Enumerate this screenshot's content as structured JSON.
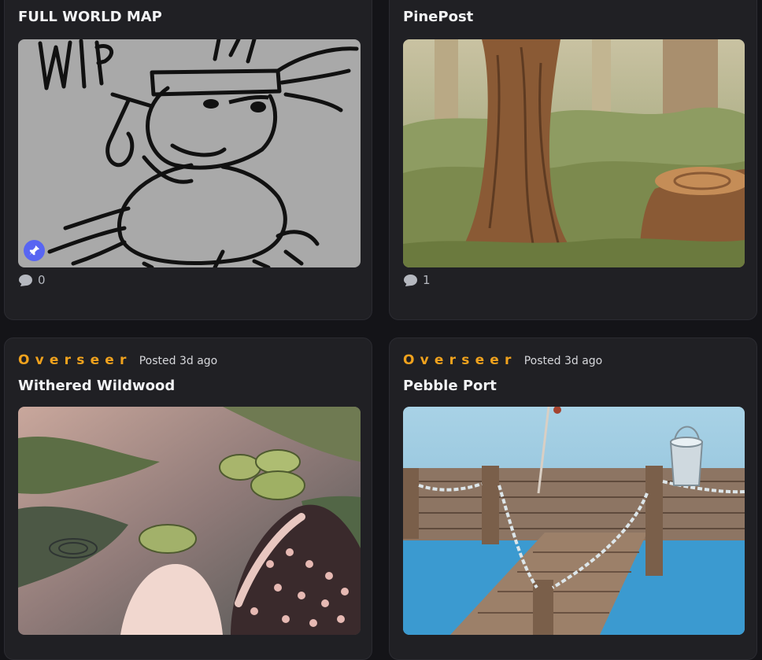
{
  "posts": [
    {
      "title": "FULL WORLD MAP",
      "comment_count": "0",
      "pinned": true,
      "image": "wip-sketch-image"
    },
    {
      "title": "PinePost",
      "comment_count": "1",
      "image": "forest-tree-stump-image"
    },
    {
      "author": "Overseer",
      "posted": "Posted 3d ago",
      "title": "Withered Wildwood",
      "image": "swamp-mushrooms-image"
    },
    {
      "author": "Overseer",
      "posted": "Posted 3d ago",
      "title": "Pebble Port",
      "image": "wooden-dock-image"
    }
  ],
  "icons": {
    "comment": "speech-bubble-icon",
    "pin": "pin-icon"
  },
  "colors": {
    "author": "#f0a21d",
    "pin_badge": "#5865f2",
    "card": "#202024",
    "background": "#141418"
  }
}
